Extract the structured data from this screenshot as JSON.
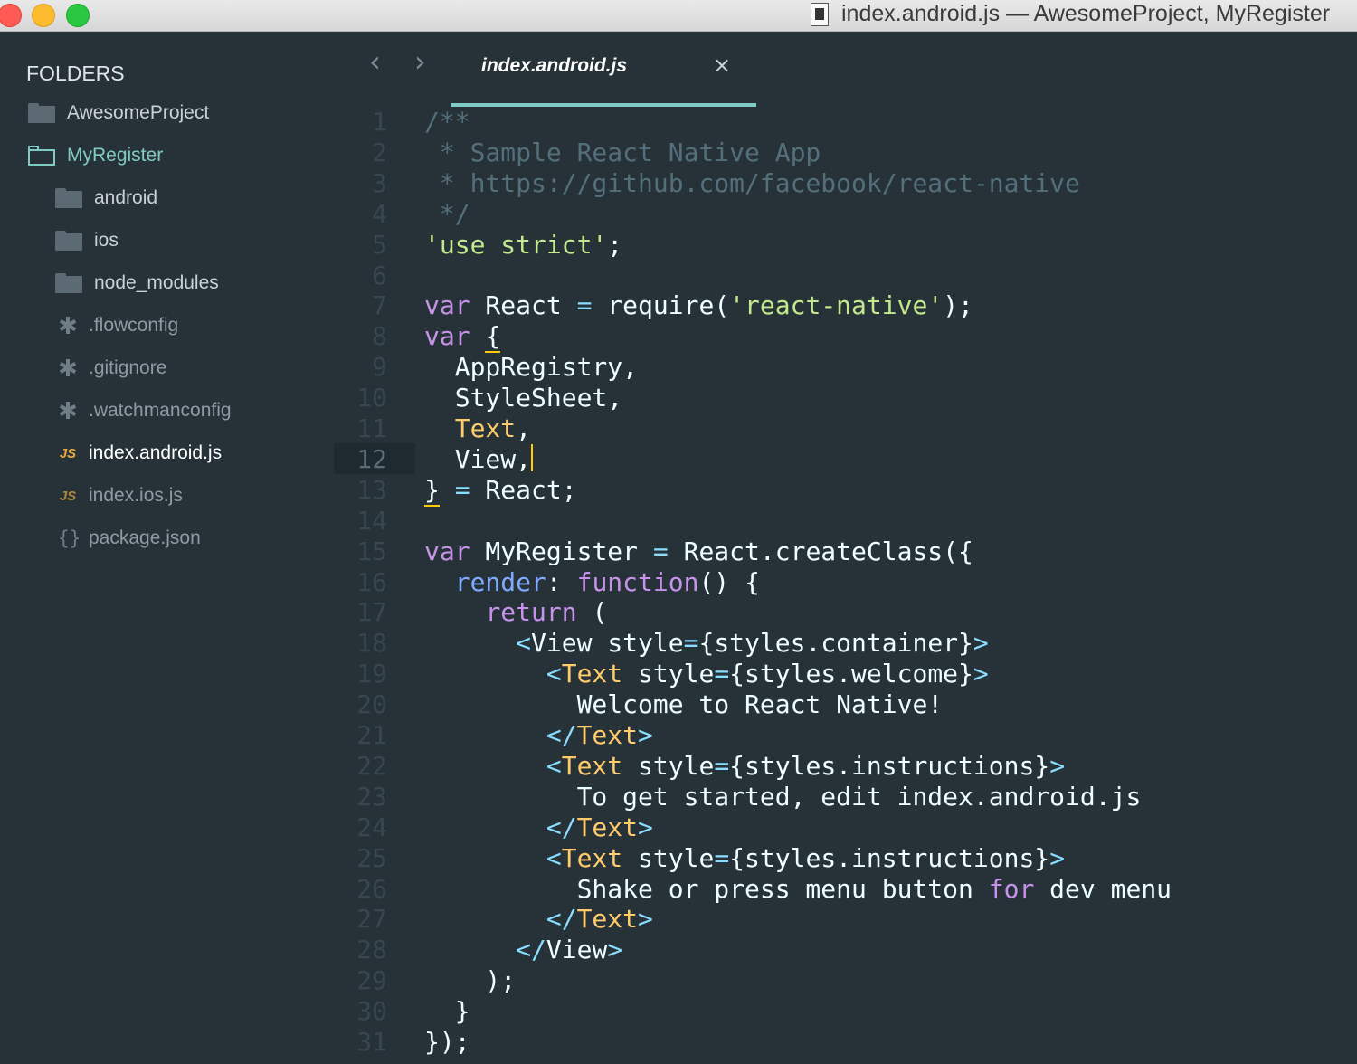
{
  "window": {
    "title": "index.android.js — AwesomeProject, MyRegister"
  },
  "sidebar": {
    "heading": "FOLDERS",
    "items": [
      {
        "label": "AwesomeProject",
        "icon": "folder-icon"
      },
      {
        "label": "MyRegister",
        "icon": "folder-open-icon"
      },
      {
        "label": "android",
        "icon": "folder-icon"
      },
      {
        "label": "ios",
        "icon": "folder-icon"
      },
      {
        "label": "node_modules",
        "icon": "folder-icon"
      },
      {
        "label": ".flowconfig",
        "icon": "config-file-icon",
        "glyph": "✱"
      },
      {
        "label": ".gitignore",
        "icon": "config-file-icon",
        "glyph": "✱"
      },
      {
        "label": ".watchmanconfig",
        "icon": "config-file-icon",
        "glyph": "✱"
      },
      {
        "label": "index.android.js",
        "icon": "js-file-icon",
        "glyph": "JS"
      },
      {
        "label": "index.ios.js",
        "icon": "js-file-icon",
        "glyph": "JS"
      },
      {
        "label": "package.json",
        "icon": "json-file-icon",
        "glyph": "{}"
      }
    ]
  },
  "tabs": {
    "back": "‹",
    "forward": "›",
    "active": {
      "label": "index.android.js",
      "close": "×"
    }
  },
  "editor": {
    "current_line": 12,
    "lines": [
      [
        [
          "/**",
          "c"
        ]
      ],
      [
        [
          " * Sample React Native App",
          "c"
        ]
      ],
      [
        [
          " * https://github.com/facebook/react-native",
          "c"
        ]
      ],
      [
        [
          " */",
          "c"
        ]
      ],
      [
        [
          "'use strict'",
          "s"
        ],
        [
          ";",
          "v"
        ]
      ],
      [],
      [
        [
          "var",
          "k"
        ],
        [
          " React ",
          "v"
        ],
        [
          "=",
          "p"
        ],
        [
          " require(",
          "v"
        ],
        [
          "'react-native'",
          "s"
        ],
        [
          ");",
          "v"
        ]
      ],
      [
        [
          "var",
          "k"
        ],
        [
          " ",
          "v"
        ],
        [
          "{",
          "v"
        ]
      ],
      [
        [
          "  AppRegistry,",
          "v"
        ]
      ],
      [
        [
          "  StyleSheet,",
          "v"
        ]
      ],
      [
        [
          "  Text",
          "y"
        ],
        [
          ",",
          "v"
        ]
      ],
      [
        [
          "  View,",
          "v"
        ]
      ],
      [
        [
          "}",
          "v"
        ],
        [
          " ",
          "v"
        ],
        [
          "=",
          "p"
        ],
        [
          " React;",
          "v"
        ]
      ],
      [],
      [
        [
          "var",
          "k"
        ],
        [
          " MyRegister ",
          "v"
        ],
        [
          "=",
          "p"
        ],
        [
          " React.createClass({",
          "v"
        ]
      ],
      [
        [
          "  ",
          "v"
        ],
        [
          "render",
          "b"
        ],
        [
          ": ",
          "v"
        ],
        [
          "function",
          "k"
        ],
        [
          "() {",
          "v"
        ]
      ],
      [
        [
          "    ",
          "v"
        ],
        [
          "return",
          "k"
        ],
        [
          " (",
          "v"
        ]
      ],
      [
        [
          "      ",
          "v"
        ],
        [
          "<",
          "p"
        ],
        [
          "View ",
          "v"
        ],
        [
          "style",
          "v"
        ],
        [
          "=",
          "p"
        ],
        [
          "{styles.container}",
          "v"
        ],
        [
          ">",
          "p"
        ]
      ],
      [
        [
          "        ",
          "v"
        ],
        [
          "<",
          "p"
        ],
        [
          "Text",
          "y"
        ],
        [
          " style",
          "v"
        ],
        [
          "=",
          "p"
        ],
        [
          "{styles.welcome}",
          "v"
        ],
        [
          ">",
          "p"
        ]
      ],
      [
        [
          "          Welcome to React Native!",
          "v"
        ]
      ],
      [
        [
          "        ",
          "v"
        ],
        [
          "</",
          "p"
        ],
        [
          "Text",
          "y"
        ],
        [
          ">",
          "p"
        ]
      ],
      [
        [
          "        ",
          "v"
        ],
        [
          "<",
          "p"
        ],
        [
          "Text",
          "y"
        ],
        [
          " style",
          "v"
        ],
        [
          "=",
          "p"
        ],
        [
          "{styles.instructions}",
          "v"
        ],
        [
          ">",
          "p"
        ]
      ],
      [
        [
          "          To get started, edit index.android.js",
          "v"
        ]
      ],
      [
        [
          "        ",
          "v"
        ],
        [
          "</",
          "p"
        ],
        [
          "Text",
          "y"
        ],
        [
          ">",
          "p"
        ]
      ],
      [
        [
          "        ",
          "v"
        ],
        [
          "<",
          "p"
        ],
        [
          "Text",
          "y"
        ],
        [
          " style",
          "v"
        ],
        [
          "=",
          "p"
        ],
        [
          "{styles.instructions}",
          "v"
        ],
        [
          ">",
          "p"
        ]
      ],
      [
        [
          "          Shake or press menu button ",
          "v"
        ],
        [
          "for",
          "k"
        ],
        [
          " dev menu",
          "v"
        ]
      ],
      [
        [
          "        ",
          "v"
        ],
        [
          "</",
          "p"
        ],
        [
          "Text",
          "y"
        ],
        [
          ">",
          "p"
        ]
      ],
      [
        [
          "      ",
          "v"
        ],
        [
          "</",
          "p"
        ],
        [
          "View",
          "v"
        ],
        [
          ">",
          "p"
        ]
      ],
      [
        [
          "    );",
          "v"
        ]
      ],
      [
        [
          "  }",
          "v"
        ]
      ],
      [
        [
          "});",
          "v"
        ]
      ]
    ]
  },
  "colors": {
    "background": "#263238",
    "accent": "#80cbc4",
    "caret": "#ffcc00"
  }
}
